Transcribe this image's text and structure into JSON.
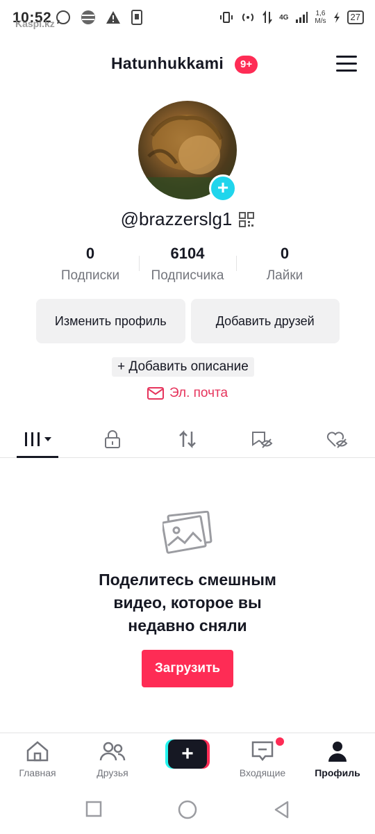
{
  "status_bar": {
    "time": "10:52",
    "watermark": "Kaspi.kz",
    "network": "4G",
    "speed_value": "1,6",
    "speed_unit": "M/s",
    "battery": "27"
  },
  "header": {
    "title": "Hatunhukkami",
    "badge": "9+"
  },
  "profile": {
    "username": "@brazzerslg1",
    "stats": [
      {
        "value": "0",
        "label": "Подписки"
      },
      {
        "value": "6104",
        "label": "Подписчика"
      },
      {
        "value": "0",
        "label": "Лайки"
      }
    ],
    "edit_profile_label": "Изменить профиль",
    "add_friends_label": "Добавить друзей",
    "add_description_label": "+ Добавить описание",
    "email_label": "Эл. почта"
  },
  "empty_state": {
    "line1": "Поделитесь смешным",
    "line2": "видео, которое вы",
    "line3": "недавно сняли",
    "upload_label": "Загрузить"
  },
  "bottom_nav": {
    "home": "Главная",
    "friends": "Друзья",
    "create": "+",
    "inbox": "Входящие",
    "profile": "Профиль"
  },
  "colors": {
    "accent": "#fe2c55",
    "cyan": "#20d5ec",
    "text": "#161823",
    "muted": "#73757c"
  }
}
